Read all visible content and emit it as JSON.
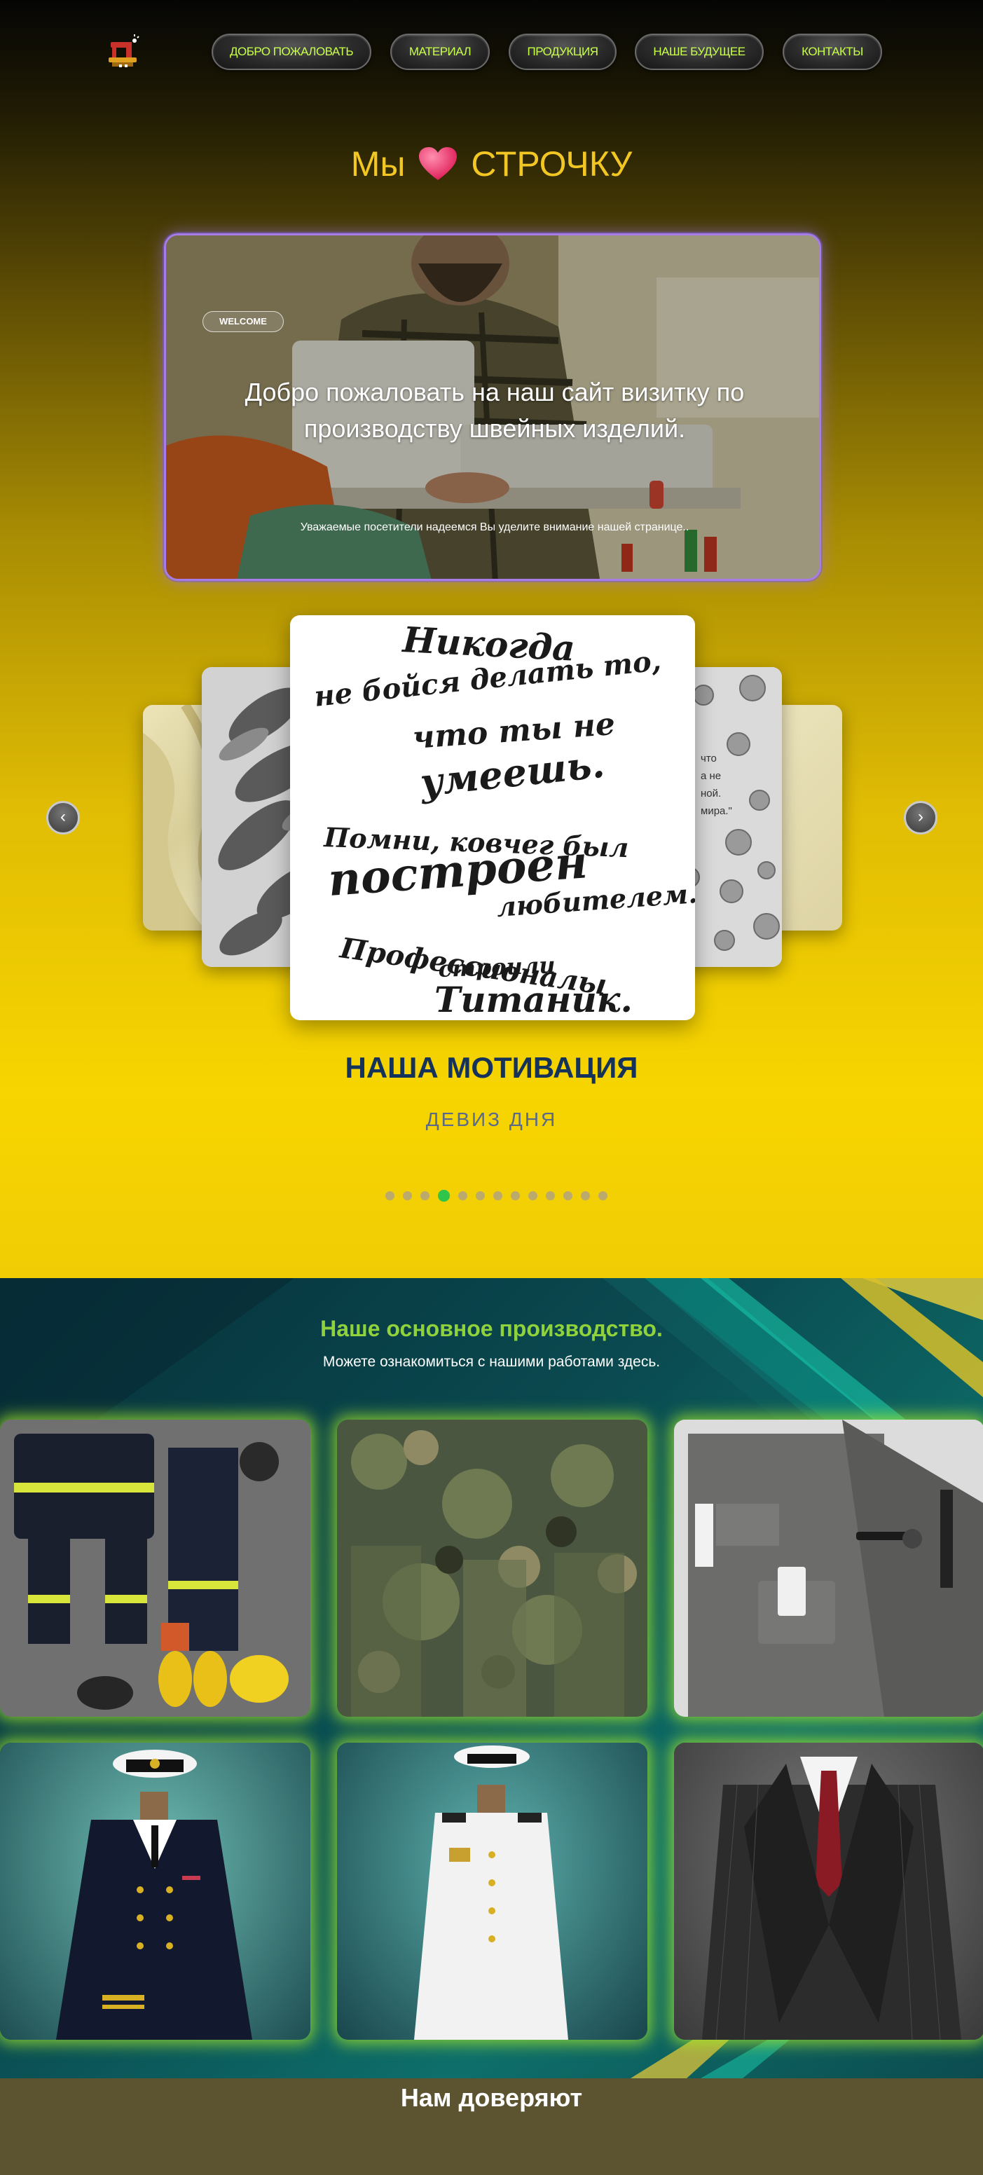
{
  "nav": {
    "items": [
      {
        "label": "ДОБРО ПОЖАЛОВАТЬ"
      },
      {
        "label": "МАТЕРИАЛ"
      },
      {
        "label": "ПРОДУКЦИЯ"
      },
      {
        "label": "НАШЕ БУДУЩЕЕ"
      },
      {
        "label": "КОНТАКТЫ"
      }
    ]
  },
  "hero": {
    "tagline_left": "Мы",
    "tagline_right": "СТРОЧКУ",
    "welcome": {
      "badge": "WELCOME",
      "heading": "Добро пожаловать на наш сайт визитку по производству швейных изделий.",
      "subtext": "Уважаемые посетители надеемся Вы уделите внимание нашей странице.."
    }
  },
  "carousel": {
    "quote_lines": [
      "Никогда",
      "не бойся делать то,",
      "что ты не",
      "умеешь.",
      "Помни, ковчег был",
      "построен",
      "любителем.",
      "Профессионалы",
      "строили",
      "Титаник."
    ],
    "side_card_text": [
      "что",
      "а не",
      "ной.",
      "мира.\""
    ],
    "title": "НАША МОТИВАЦИЯ",
    "subtitle": "ДЕВИЗ ДНЯ",
    "prev_label": "‹",
    "next_label": "›",
    "dot_count": 13,
    "active_dot": 3
  },
  "production": {
    "title": "Наше основное производство.",
    "subtitle": "Можете ознакомиться с нашими работами здесь."
  },
  "trust": {
    "title": "Нам доверяют"
  },
  "colors": {
    "nav_text": "#c8ff4a",
    "tagline": "#f2c623",
    "production_title": "#8fd23c",
    "tile_glow": "#a5eb28",
    "dot_active": "#2fc44a"
  }
}
